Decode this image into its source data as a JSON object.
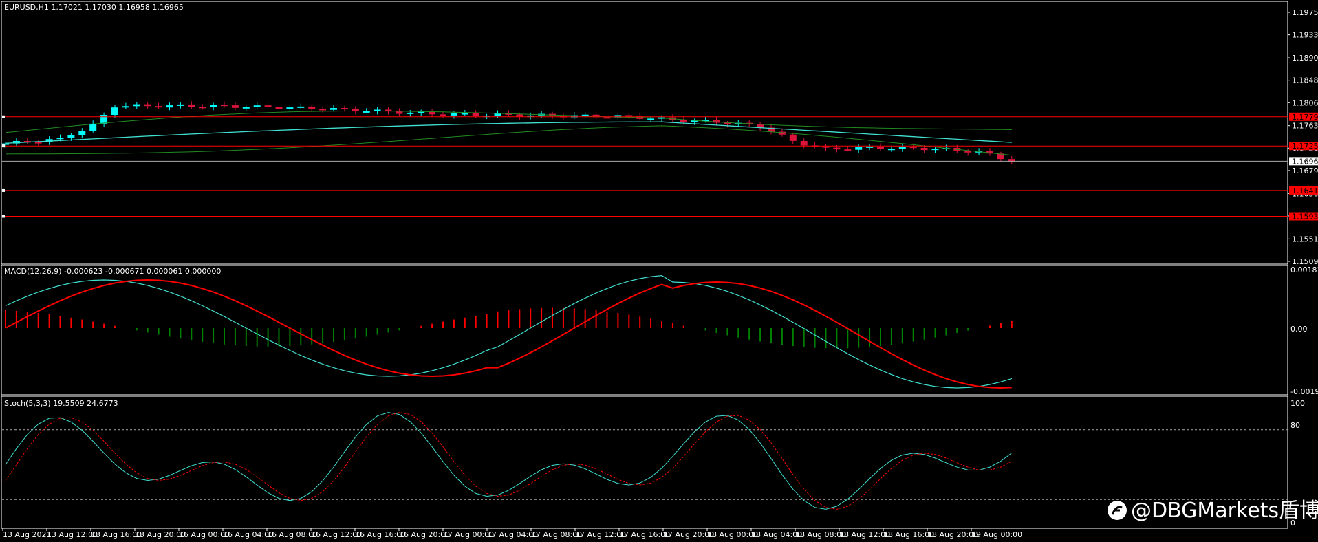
{
  "main": {
    "symbol_info": "EURUSD,H1  1.17021 1.17030 1.16958 1.16965",
    "price_ticks": [
      "1.19750",
      "1.19330",
      "1.18900",
      "1.18480",
      "1.18060",
      "1.17630",
      "1.17210",
      "1.16790",
      "1.16360",
      "1.15940",
      "1.15510",
      "1.15090"
    ],
    "current_price": "1.16965",
    "hlines": [
      {
        "label": "1.17796",
        "value": 1.17796
      },
      {
        "label": "1.17250",
        "value": 1.1725
      },
      {
        "label": "1.16417",
        "value": 1.16417
      },
      {
        "label": "1.15933",
        "value": 1.15933
      }
    ]
  },
  "macd": {
    "info": "MACD(12,26,9) -0.000623 -0.000671 0.000061 0.000000",
    "ticks": [
      "0.001814",
      "0.00",
      "-0.001958"
    ]
  },
  "stoch": {
    "info": "Stoch(5,3,3) 19.5509 24.6773",
    "ticks": [
      "100",
      "80",
      "0"
    ]
  },
  "time_axis": [
    "13 Aug 2021",
    "13 Aug 12:00",
    "13 Aug 16:00",
    "13 Aug 20:00",
    "16 Aug 00:00",
    "16 Aug 04:00",
    "16 Aug 08:00",
    "16 Aug 12:00",
    "16 Aug 16:00",
    "16 Aug 20:00",
    "17 Aug 00:00",
    "17 Aug 04:00",
    "17 Aug 08:00",
    "17 Aug 12:00",
    "17 Aug 16:00",
    "17 Aug 20:00",
    "18 Aug 00:00",
    "18 Aug 04:00",
    "18 Aug 08:00",
    "18 Aug 12:00",
    "18 Aug 16:00",
    "18 Aug 20:00",
    "19 Aug 00:00"
  ],
  "watermark": "@DBGMarkets盾博",
  "colors": {
    "bull": "#00ffff",
    "bear": "#dc143c",
    "signal": "#ff0000",
    "hist_up": "#ff0000",
    "hist_down": "#008000",
    "bands": "#228b22",
    "ma": "#40e0d0",
    "hline": "#ff0000"
  }
}
